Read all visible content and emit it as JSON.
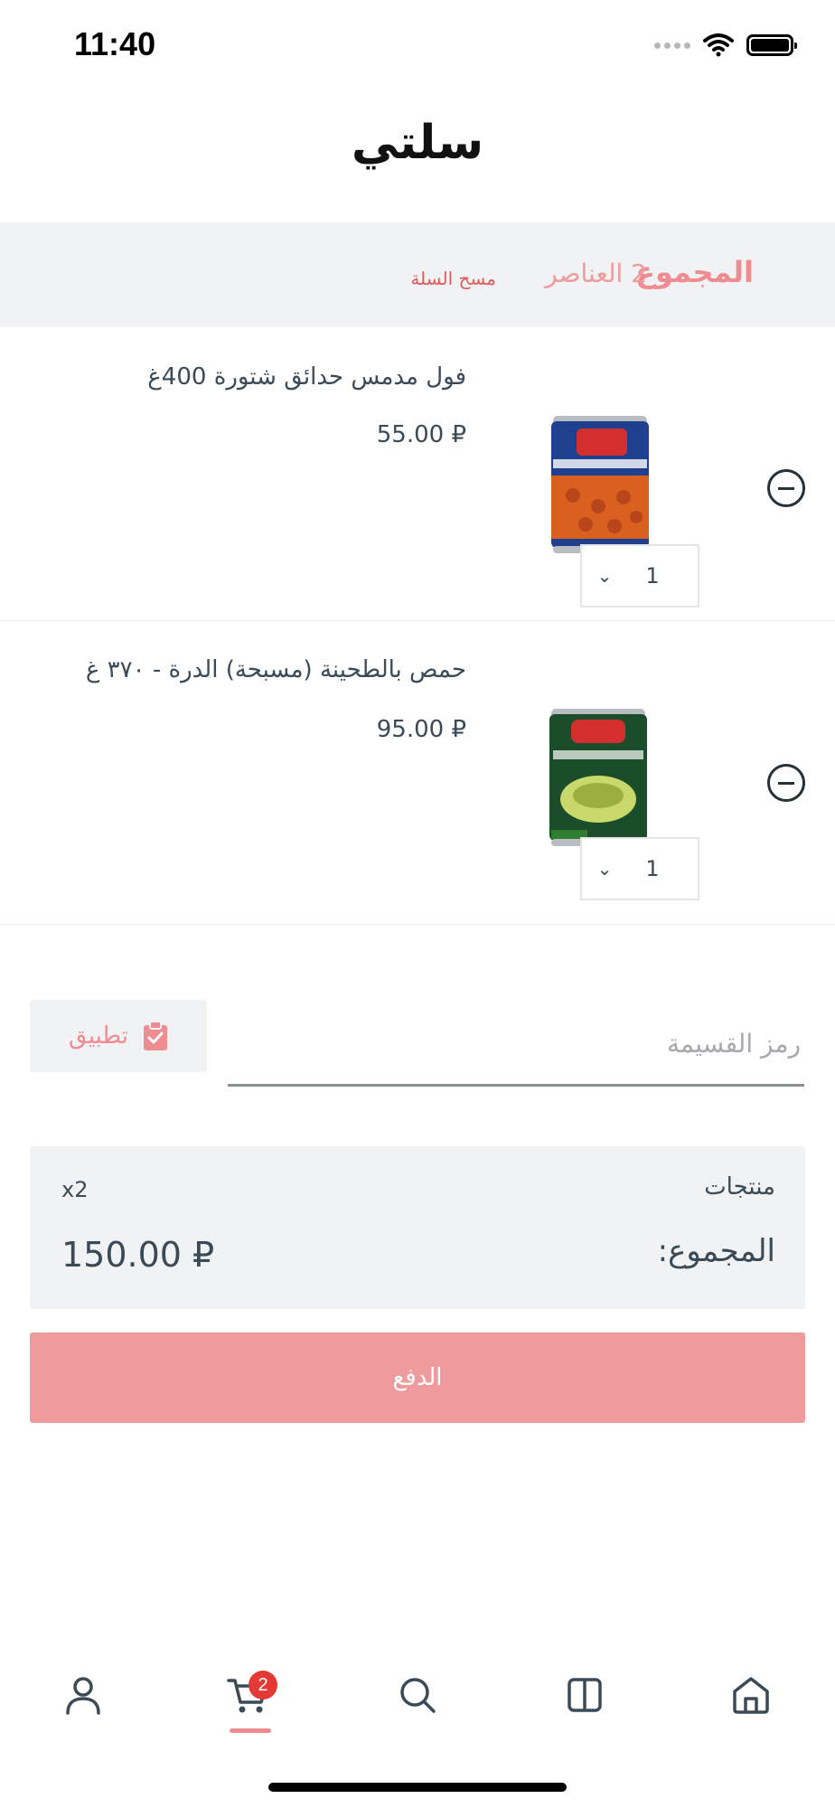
{
  "status_bar": {
    "time": "11:40"
  },
  "page": {
    "title": "سلتي"
  },
  "summary": {
    "total_label": "المجموع",
    "items_count": "2 العناصر",
    "clear_cart": "مسح السلة"
  },
  "cart_items": [
    {
      "name": "فول مدمس حدائق شتورة 400غ",
      "price": "55.00 ₽",
      "quantity": "1",
      "image_label": "Chtoura Garden"
    },
    {
      "name": "حمص بالطحينة (مسبحة) الدرة - ٣٧٠ غ",
      "price": "95.00 ₽",
      "quantity": "1",
      "image_label": "Durra"
    }
  ],
  "coupon": {
    "placeholder": "رمز القسيمة",
    "apply_label": "تطبيق"
  },
  "totals": {
    "products_label": "منتجات",
    "products_count": "x2",
    "sum_label": "المجموع:",
    "sum_value": "150.00 ₽"
  },
  "checkout": {
    "pay_label": "الدفع"
  },
  "tabbar": {
    "cart_badge": "2"
  },
  "icons": {
    "profile": "user-icon",
    "cart": "cart-icon",
    "search": "search-icon",
    "categories": "book-icon",
    "home": "home-icon"
  },
  "colors": {
    "accent": "#ef8c91",
    "pay_button": "#ef9a9d",
    "danger": "#e05b5b",
    "badge": "#e53935",
    "panel": "#f1f2f4",
    "text": "#3a4a57"
  }
}
